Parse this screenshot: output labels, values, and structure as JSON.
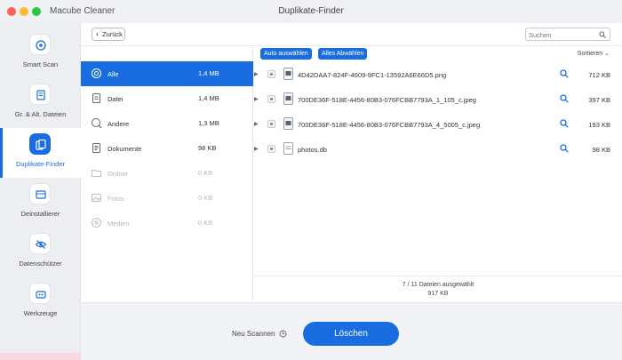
{
  "window": {
    "app_name": "Macube Cleaner",
    "title": "Duplikate-Finder"
  },
  "sidebar": {
    "items": [
      {
        "label": "Smart Scan",
        "icon": "target-icon",
        "active": false
      },
      {
        "label": "Gr. & Alt. Dateien",
        "icon": "document-icon",
        "active": false
      },
      {
        "label": "Duplikate-Finder",
        "icon": "duplicate-files-icon",
        "active": true
      },
      {
        "label": "Deinstallierer",
        "icon": "app-box-icon",
        "active": false
      },
      {
        "label": "Datenschützer",
        "icon": "eye-slash-icon",
        "active": false
      },
      {
        "label": "Werkzeuge",
        "icon": "toolbox-icon",
        "active": false
      }
    ]
  },
  "toolbar": {
    "back_label": "Zurück",
    "search_placeholder": "Suchen"
  },
  "categories": [
    {
      "name": "Alle",
      "size": "1,4 MB",
      "icon": "all-categories-icon",
      "active": true,
      "enabled": true
    },
    {
      "name": "Datei",
      "size": "1,4 MB",
      "icon": "file-icon",
      "active": false,
      "enabled": true
    },
    {
      "name": "Andere",
      "size": "1,3 MB",
      "icon": "other-icon",
      "active": false,
      "enabled": true
    },
    {
      "name": "Dokumente",
      "size": "98 KB",
      "icon": "documents-icon",
      "active": false,
      "enabled": true
    },
    {
      "name": "Ordner",
      "size": "0 KB",
      "icon": "folder-icon",
      "active": false,
      "enabled": false
    },
    {
      "name": "Fotos",
      "size": "0 KB",
      "icon": "photo-icon",
      "active": false,
      "enabled": false
    },
    {
      "name": "Medien",
      "size": "0 KB",
      "icon": "media-icon",
      "active": false,
      "enabled": false
    }
  ],
  "files_panel": {
    "auto_select_label": "Auto auswählen",
    "deselect_all_label": "Alles Abwählen",
    "sort_label": "Sortieren",
    "files": [
      {
        "name": "4D42DAA7-824F-4609-9FC1-13592A6E66D5.png",
        "size": "712 KB"
      },
      {
        "name": "700DE36F-518E-4456-80B3-076FCBB7793A_1_105_c.jpeg",
        "size": "397 KB"
      },
      {
        "name": "700DE36F-518E-4456-80B3-076FCBB7793A_4_5005_c.jpeg",
        "size": "193 KB"
      },
      {
        "name": "photos.db",
        "size": "98 KB"
      }
    ],
    "summary_count": "7 / 11 Dateien ausgewählt",
    "summary_size": "917 KB"
  },
  "footer": {
    "rescan_label": "Neu Scannen",
    "delete_label": "Löschen"
  },
  "colors": {
    "accent": "#1a6de0",
    "sidebar_bg": "#eceef2",
    "footer_bg": "#f2f3f6"
  }
}
